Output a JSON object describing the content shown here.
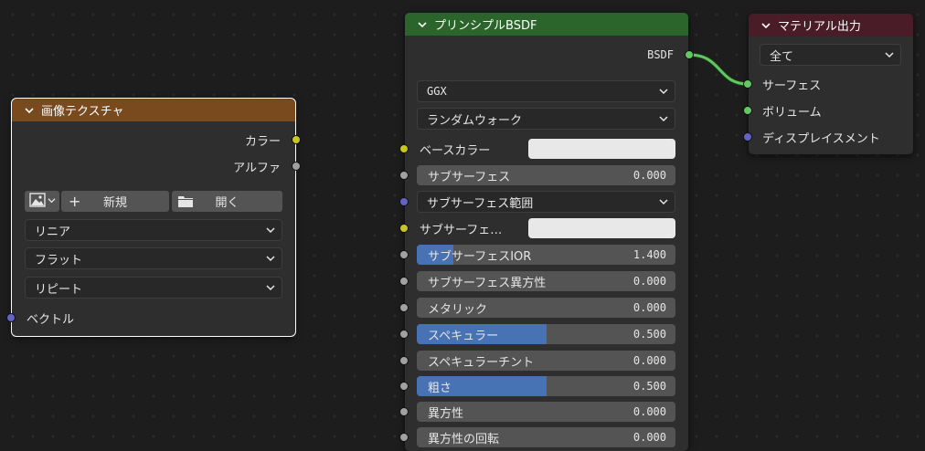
{
  "image_texture_node": {
    "title": "画像テクスチャ",
    "header_color": "#7a4a1f",
    "outputs": [
      {
        "label": "カラー",
        "socket": "yellow"
      },
      {
        "label": "アルファ",
        "socket": "gray"
      }
    ],
    "image_type_icon": "image-icon",
    "new_label": "新規",
    "open_label": "開く",
    "interpolation": "リニア",
    "projection": "フラット",
    "extension": "リピート",
    "input_vector": "ベクトル"
  },
  "principled_node": {
    "title": "プリンシプルBSDF",
    "header_color": "#2b652b",
    "output": "BSDF",
    "distribution": "GGX",
    "subsurface_method": "ランダムウォーク",
    "base_color_label": "ベースカラー",
    "subsurface_label": "サブサーフェス",
    "subsurface_value": "0.000",
    "subsurface_radius_label": "サブサーフェス範囲",
    "subsurface_color_label": "サブサーフェ…",
    "subsurface_ior_label": "サブサーフェスIOR",
    "subsurface_ior_value": "1.400",
    "subsurface_ior_fill": 0.14,
    "subsurface_aniso_label": "サブサーフェス異方性",
    "subsurface_aniso_value": "0.000",
    "metallic_label": "メタリック",
    "metallic_value": "0.000",
    "specular_label": "スペキュラー",
    "specular_value": "0.500",
    "specular_fill": 0.5,
    "specular_tint_label": "スペキュラーチント",
    "specular_tint_value": "0.000",
    "roughness_label": "粗さ",
    "roughness_value": "0.500",
    "roughness_fill": 0.5,
    "anisotropic_label": "異方性",
    "anisotropic_value": "0.000",
    "anisotropic_rotation_label": "異方性の回転",
    "anisotropic_rotation_value": "0.000"
  },
  "material_output_node": {
    "title": "マテリアル出力",
    "header_color": "#4a1c28",
    "target": "全て",
    "inputs": [
      {
        "label": "サーフェス",
        "socket": "green"
      },
      {
        "label": "ボリューム",
        "socket": "green"
      },
      {
        "label": "ディスプレイスメント",
        "socket": "purple"
      }
    ]
  },
  "link_color": "#63c763"
}
